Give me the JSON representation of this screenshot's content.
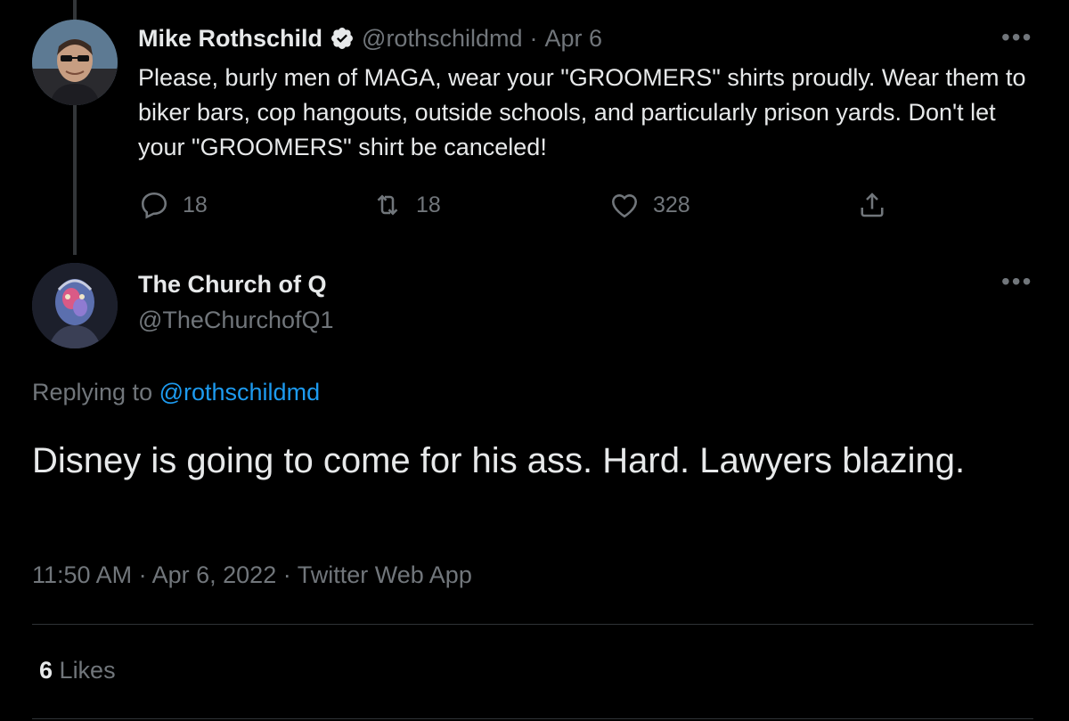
{
  "colors": {
    "background": "#000000",
    "text_primary": "#e7e9ea",
    "text_muted": "#71767b",
    "link": "#1d9bf0",
    "verified": "#e7e9ea",
    "divider": "#2f3336"
  },
  "parent_tweet": {
    "author_name": "Mike Rothschild",
    "verified_icon": "verified-badge-icon",
    "handle": "@rothschildmd",
    "separator": "·",
    "date": "Apr 6",
    "text": "Please, burly men of MAGA, wear your \"GROOMERS\" shirts proudly. Wear them to biker bars, cop hangouts, outside schools, and particularly prison yards. Don't let your \"GROOMERS\" shirt be canceled!",
    "more_icon": "more-icon",
    "more_label": "•••",
    "actions": {
      "reply_count": "18",
      "retweet_count": "18",
      "like_count": "328"
    }
  },
  "reply_tweet": {
    "author_name": "The Church of Q",
    "handle": "@TheChurchofQ1",
    "more_label": "•••",
    "replying_prefix": "Replying to",
    "replying_to": "@rothschildmd",
    "text": "Disney is going to come for his ass. Hard. Lawyers blazing.",
    "time": "11:50 AM",
    "date": "Apr 6, 2022",
    "source": "Twitter Web App",
    "separator": "·",
    "likes_count": "6",
    "likes_label": "Likes"
  }
}
